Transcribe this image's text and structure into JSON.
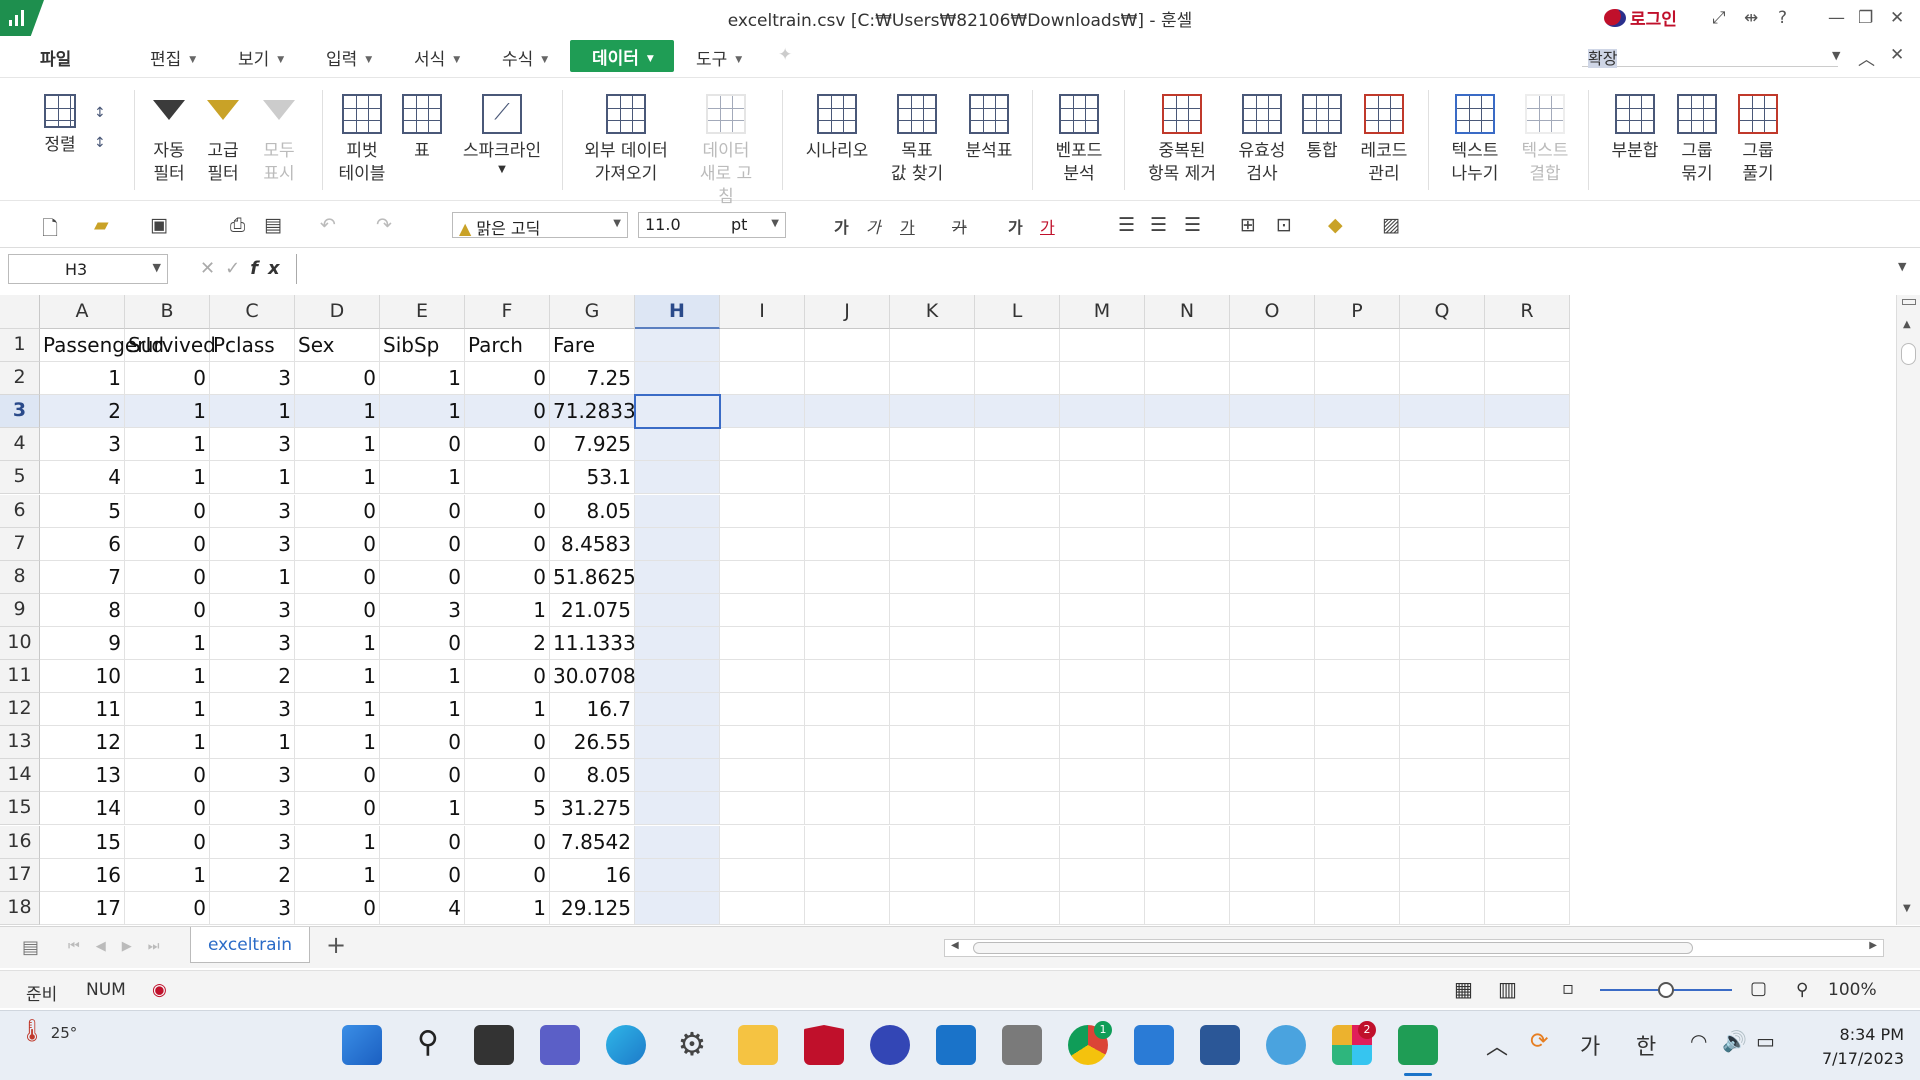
{
  "window": {
    "title": "exceltrain.csv [C:₩Users₩82106₩Downloads₩] - 훈셀",
    "login": "로그인"
  },
  "menu": {
    "items": [
      {
        "label": "파일"
      },
      {
        "label": "편집"
      },
      {
        "label": "보기"
      },
      {
        "label": "입력"
      },
      {
        "label": "서식"
      },
      {
        "label": "수식"
      },
      {
        "label": "데이터"
      },
      {
        "label": "도구"
      }
    ],
    "search_value": "확장"
  },
  "ribbon": {
    "sort": "정렬",
    "auto_filter": "자동\n필터",
    "adv_filter": "고급\n필터",
    "show_all": "모두\n표시",
    "pivot": "피벗\n테이블",
    "table": "표",
    "sparkline": "스파크라인",
    "ext_data": "외부 데이터\n가져오기",
    "refresh": "데이터\n새로 고침",
    "scenario": "시나리오",
    "goal_seek": "목표\n값 찾기",
    "analysis": "분석표",
    "venn": "벤포드\n분석",
    "remove_dup": "중복된\n항목 제거",
    "validation": "유효성\n검사",
    "consolidate": "통합",
    "record": "레코드\n관리",
    "text_split": "텍스트\n나누기",
    "text_join": "텍스트\n결합",
    "subtotal": "부분합",
    "group": "그룹\n묶기",
    "ungroup": "그룹\n풀기"
  },
  "toolbar": {
    "font": "맑은 고딕",
    "size": "11.0",
    "unit": "pt",
    "format_glyphs": [
      "가",
      "가",
      "가",
      "가",
      "가",
      "가"
    ]
  },
  "formula": {
    "cell_ref": "H3",
    "value": ""
  },
  "columns": [
    "A",
    "B",
    "C",
    "D",
    "E",
    "F",
    "G",
    "H",
    "I",
    "J",
    "K",
    "L",
    "M",
    "N",
    "O",
    "P",
    "Q",
    "R"
  ],
  "selected_column": "H",
  "selected_row": "3",
  "rows": [
    {
      "num": "1",
      "cells": [
        "PassengerId",
        "Survived",
        "Pclass",
        "Sex",
        "SibSp",
        "Parch",
        "Fare"
      ]
    },
    {
      "num": "2",
      "cells": [
        "1",
        "0",
        "3",
        "0",
        "1",
        "0",
        "7.25"
      ]
    },
    {
      "num": "3",
      "cells": [
        "2",
        "1",
        "1",
        "1",
        "1",
        "0",
        "71.2833"
      ]
    },
    {
      "num": "4",
      "cells": [
        "3",
        "1",
        "3",
        "1",
        "0",
        "0",
        "7.925"
      ]
    },
    {
      "num": "5",
      "cells": [
        "4",
        "1",
        "1",
        "1",
        "1",
        "",
        "53.1"
      ]
    },
    {
      "num": "6",
      "cells": [
        "5",
        "0",
        "3",
        "0",
        "0",
        "0",
        "8.05"
      ]
    },
    {
      "num": "7",
      "cells": [
        "6",
        "0",
        "3",
        "0",
        "0",
        "0",
        "8.4583"
      ]
    },
    {
      "num": "8",
      "cells": [
        "7",
        "0",
        "1",
        "0",
        "0",
        "0",
        "51.8625"
      ]
    },
    {
      "num": "9",
      "cells": [
        "8",
        "0",
        "3",
        "0",
        "3",
        "1",
        "21.075"
      ]
    },
    {
      "num": "10",
      "cells": [
        "9",
        "1",
        "3",
        "1",
        "0",
        "2",
        "11.1333"
      ]
    },
    {
      "num": "11",
      "cells": [
        "10",
        "1",
        "2",
        "1",
        "1",
        "0",
        "30.0708"
      ]
    },
    {
      "num": "12",
      "cells": [
        "11",
        "1",
        "3",
        "1",
        "1",
        "1",
        "16.7"
      ]
    },
    {
      "num": "13",
      "cells": [
        "12",
        "1",
        "1",
        "1",
        "0",
        "0",
        "26.55"
      ]
    },
    {
      "num": "14",
      "cells": [
        "13",
        "0",
        "3",
        "0",
        "0",
        "0",
        "8.05"
      ]
    },
    {
      "num": "15",
      "cells": [
        "14",
        "0",
        "3",
        "0",
        "1",
        "5",
        "31.275"
      ]
    },
    {
      "num": "16",
      "cells": [
        "15",
        "0",
        "3",
        "1",
        "0",
        "0",
        "7.8542"
      ]
    },
    {
      "num": "17",
      "cells": [
        "16",
        "1",
        "2",
        "1",
        "0",
        "0",
        "16"
      ]
    },
    {
      "num": "18",
      "cells": [
        "17",
        "0",
        "3",
        "0",
        "4",
        "1",
        "29.125"
      ]
    }
  ],
  "sheet": {
    "tab": "exceltrain",
    "add": "+"
  },
  "status": {
    "ready": "준비",
    "num": "NUM",
    "zoom": "100%"
  },
  "taskbar": {
    "temp": "25°",
    "ime_ga": "가",
    "ime_han": "한",
    "time": "8:34 PM",
    "date": "7/17/2023",
    "badge_chrome": "1",
    "badge_slack": "2"
  },
  "colors": {
    "accent": "#1f9d55",
    "selection": "#3a6bc6",
    "selection_fill": "#e6ecf7",
    "login_red": "#c0102b"
  }
}
